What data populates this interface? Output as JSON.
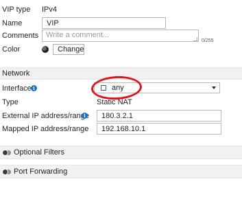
{
  "general": {
    "vip_type_label": "VIP type",
    "vip_type_value": "IPv4",
    "name_label": "Name",
    "name_value": "VIP",
    "comments_label": "Comments",
    "comments_placeholder": "Write a comment...",
    "comments_counter": "0/255",
    "color_label": "Color",
    "color_button": "Change"
  },
  "network": {
    "section_title": "Network",
    "interface_label": "Interface",
    "interface_value": "any",
    "type_label": "Type",
    "type_value": "Static NAT",
    "external_ip_label": "External IP address/range",
    "external_ip_value": "180.3.2.1",
    "mapped_ip_label": "Mapped IP address/range",
    "mapped_ip_value": "192.168.10.1"
  },
  "toggles": {
    "optional_filters": "Optional Filters",
    "port_forwarding": "Port Forwarding"
  },
  "colors": {
    "annotation_ring": "#e0141b",
    "info_icon": "#1f6fc0",
    "section_bg": "#f1f1f1"
  },
  "icons": {
    "info": "info-icon",
    "color": "color-palette-icon",
    "toggle": "toggle-off-icon",
    "dropdown": "chevron-down-icon"
  }
}
